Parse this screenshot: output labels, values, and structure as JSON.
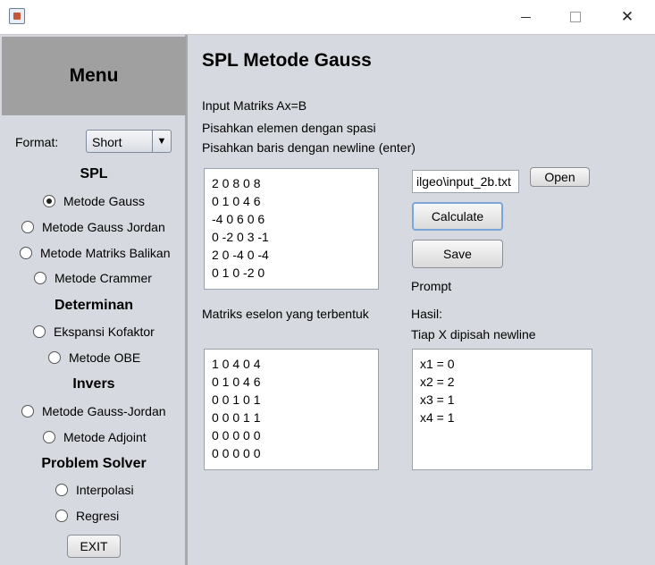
{
  "window": {
    "icon": "java-cup-icon",
    "controls": {
      "minimize": "minimize-icon",
      "maximize": "maximize-icon",
      "close": "✕"
    }
  },
  "sidebar": {
    "menu_title": "Menu",
    "format_label": "Format:",
    "format_value": "Short",
    "format_arrow": "▼",
    "spl_title": "SPL",
    "spl_options": [
      "Metode Gauss",
      "Metode Gauss Jordan",
      "Metode Matriks Balikan",
      "Metode Crammer"
    ],
    "determinan_title": "Determinan",
    "determinan_options": [
      "Ekspansi Kofaktor",
      "Metode OBE"
    ],
    "invers_title": "Invers",
    "invers_options": [
      "Metode Gauss-Jordan",
      "Metode Adjoint"
    ],
    "problem_title": "Problem Solver",
    "problem_options": [
      "Interpolasi",
      "Regresi"
    ],
    "selected": "Metode Gauss",
    "exit_label": "EXIT"
  },
  "main": {
    "title": "SPL Metode Gauss",
    "instructions": [
      "Input Matriks Ax=B",
      "Pisahkan elemen dengan spasi",
      "Pisahkan baris dengan newline (enter)"
    ],
    "input_matrix": "2 0 8 0 8\n0 1 0 4 6\n-4 0 6 0 6\n0 -2 0 3 -1\n2 0 -4 0 -4\n0 1 0 -2 0",
    "file_path": "ilgeo\\input_2b.txt",
    "open_label": "Open",
    "calculate_label": "Calculate",
    "save_label": "Save",
    "prompt_label": "Prompt",
    "echelon_label": "Matriks eselon yang terbentuk",
    "echelon_matrix": "1 0 4 0 4\n0 1 0 4 6\n0 0 1 0 1\n0 0 0 1 1\n0 0 0 0 0\n0 0 0 0 0",
    "result_label": "Hasil:",
    "result_sublabel": "Tiap X dipisah newline",
    "result_text": "x1 = 0\nx2 = 2\nx3 = 1\nx4 = 1"
  }
}
